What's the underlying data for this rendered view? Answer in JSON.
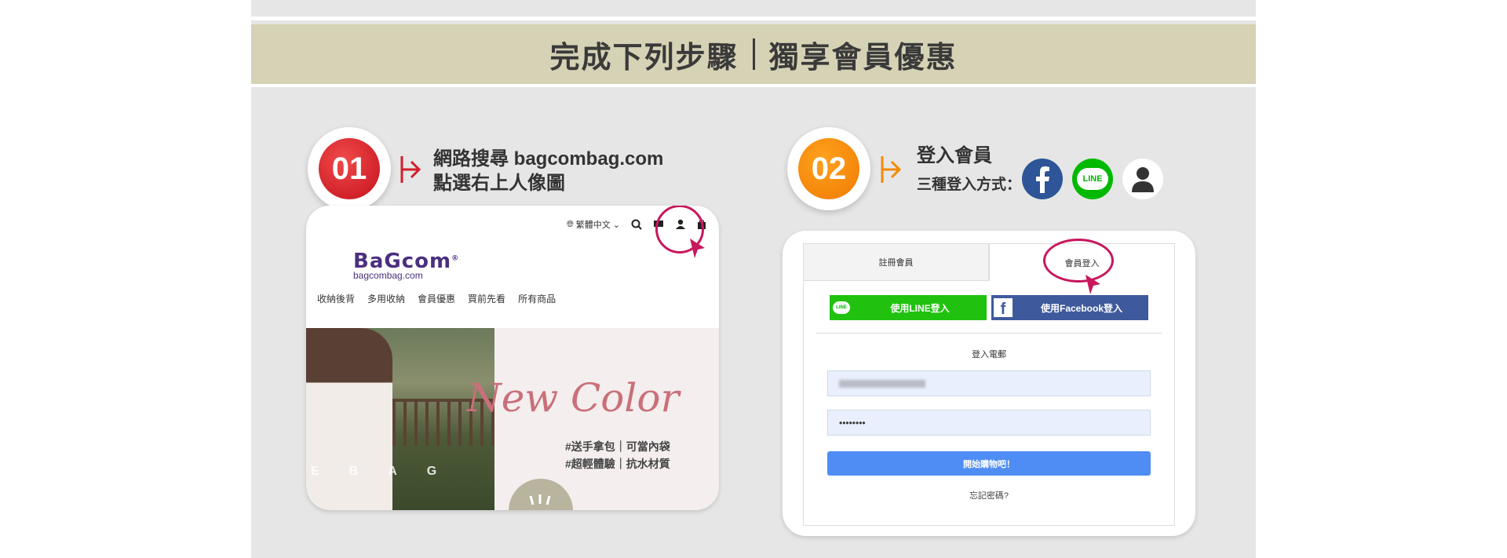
{
  "banner": {
    "part1": "完成下列步驟",
    "part2": "獨享會員優惠"
  },
  "step1": {
    "number": "01",
    "line1": "網路搜尋 bagcombag.com",
    "line2": "點選右上人像圖"
  },
  "step2": {
    "number": "02",
    "line1": "登入會員",
    "line2": "三種登入方式："
  },
  "colors": {
    "step1": "#d31f2b",
    "step2": "#f38a0a",
    "highlight": "#c8175d",
    "banner": "#d6d2b5",
    "line": "#00b900",
    "facebook": "#3b5998",
    "submit": "#4f8df4"
  },
  "social_icons": [
    "facebook-icon",
    "line-icon",
    "member-icon"
  ],
  "social": {
    "line_text": "LINE"
  },
  "shop": {
    "language": "繁體中文",
    "logo_name": "BaGcom",
    "logo_mark": "®",
    "logo_url": "bagcombag.com",
    "nav": [
      "收納後背",
      "多用收納",
      "會員優惠",
      "買前先看",
      "所有商品"
    ],
    "hero_title": "New Color",
    "hero_tags": [
      "#送手拿包｜可當內袋",
      "#超輕體驗｜抗水材質"
    ],
    "hero_letters": [
      "E",
      "B",
      "A",
      "G"
    ]
  },
  "login": {
    "tab_register": "註冊會員",
    "tab_login": "會員登入",
    "line_button": "使用LINE登入",
    "line_icon_text": "LINE",
    "facebook_button": "使用Facebook登入",
    "email_label": "登入電郵",
    "password_value": "••••••••",
    "submit_button": "開始購物吧！",
    "forgot": "忘記密碼?"
  }
}
